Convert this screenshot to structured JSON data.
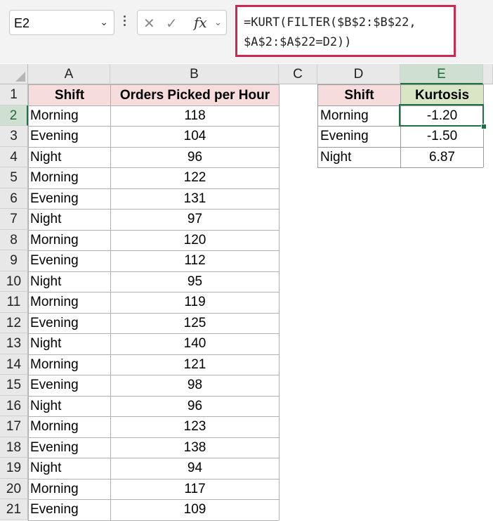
{
  "namebox": {
    "value": "E2"
  },
  "formula_bar": {
    "fx_label": "fx",
    "formula": "=KURT(FILTER($B$2:$B$22,\n$A$2:$A$22=D2))"
  },
  "columns": [
    "A",
    "B",
    "C",
    "D",
    "E"
  ],
  "row_numbers": [
    "1",
    "2",
    "3",
    "4",
    "5",
    "6",
    "7",
    "8",
    "9",
    "10",
    "11",
    "12",
    "13",
    "14",
    "15",
    "16",
    "17",
    "18",
    "19",
    "20",
    "21"
  ],
  "table1": {
    "headers": [
      "Shift",
      "Orders Picked per Hour"
    ],
    "rows": [
      [
        "Morning",
        "118"
      ],
      [
        "Evening",
        "104"
      ],
      [
        "Night",
        "96"
      ],
      [
        "Morning",
        "122"
      ],
      [
        "Evening",
        "131"
      ],
      [
        "Night",
        "97"
      ],
      [
        "Morning",
        "120"
      ],
      [
        "Evening",
        "112"
      ],
      [
        "Night",
        "95"
      ],
      [
        "Morning",
        "119"
      ],
      [
        "Evening",
        "125"
      ],
      [
        "Night",
        "140"
      ],
      [
        "Morning",
        "121"
      ],
      [
        "Evening",
        "98"
      ],
      [
        "Night",
        "96"
      ],
      [
        "Morning",
        "123"
      ],
      [
        "Evening",
        "138"
      ],
      [
        "Night",
        "94"
      ],
      [
        "Morning",
        "117"
      ],
      [
        "Evening",
        "109"
      ]
    ]
  },
  "table2": {
    "headers": [
      "Shift",
      "Kurtosis"
    ],
    "rows": [
      [
        "Morning",
        "-1.20"
      ],
      [
        "Evening",
        "-1.50"
      ],
      [
        "Night",
        "6.87"
      ]
    ]
  },
  "selected_cell": "E2",
  "colors": {
    "accent_green": "#1e7145",
    "formula_border": "#cc2a51",
    "header1_fill": "#f6dcdc",
    "header2_fill": "#d9e6c6"
  },
  "icons": [
    "chevron-down-icon",
    "more-options-icon",
    "cancel-icon",
    "enter-icon",
    "insert-function-icon"
  ]
}
